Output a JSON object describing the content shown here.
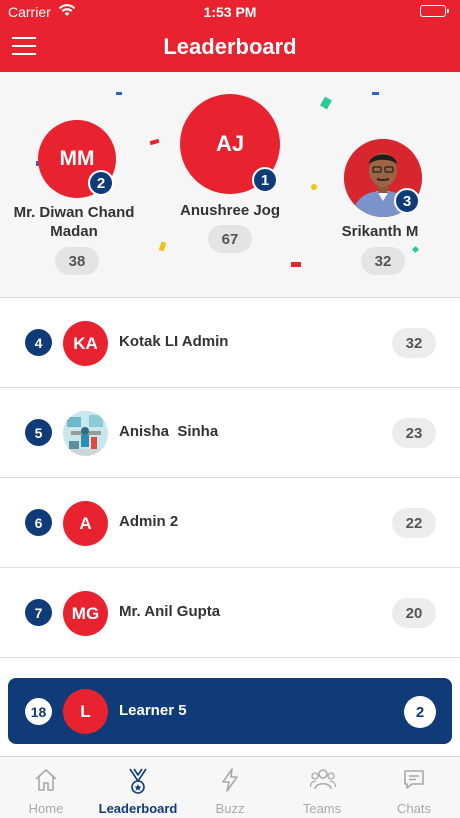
{
  "status_bar": {
    "carrier": "Carrier",
    "time": "1:53 PM"
  },
  "header": {
    "title": "Leaderboard",
    "menu_icon": "hamburger-menu-icon"
  },
  "podium": [
    {
      "rank": "2",
      "initials": "MM",
      "name": "Mr. Diwan Chand Madan",
      "score": "38"
    },
    {
      "rank": "1",
      "initials": "AJ",
      "name": "Anushree Jog",
      "score": "67"
    },
    {
      "rank": "3",
      "initials": "",
      "name": "Srikanth M",
      "score": "32",
      "avatar": "profile-photo"
    }
  ],
  "list": [
    {
      "rank": "4",
      "initials": "KA",
      "name": "Kotak LI Admin",
      "score": "32"
    },
    {
      "rank": "5",
      "initials": "",
      "name": "Anisha  Sinha",
      "score": "23",
      "avatar": "profile-photo"
    },
    {
      "rank": "6",
      "initials": "A",
      "name": "Admin 2",
      "score": "22"
    },
    {
      "rank": "7",
      "initials": "MG",
      "name": "Mr. Anil Gupta",
      "score": "20"
    }
  ],
  "current_user": {
    "rank": "18",
    "initials": "L",
    "name": "Learner 5",
    "score": "2"
  },
  "tabs": [
    {
      "label": "Home",
      "icon": "home-icon",
      "active": false
    },
    {
      "label": "Leaderboard",
      "icon": "medal-icon",
      "active": true
    },
    {
      "label": "Buzz",
      "icon": "lightning-icon",
      "active": false
    },
    {
      "label": "Teams",
      "icon": "people-icon",
      "active": false
    },
    {
      "label": "Chats",
      "icon": "chat-icon",
      "active": false
    }
  ],
  "colors": {
    "brand_red": "#e8222e",
    "navy": "#0f3b78",
    "battery_green": "#4cd964"
  }
}
